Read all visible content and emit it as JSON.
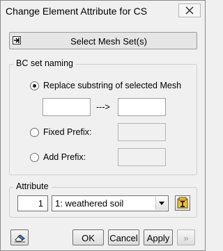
{
  "window": {
    "title": "Change Element Attribute for CS"
  },
  "select_mesh": {
    "label": "Select Mesh Set(s)"
  },
  "bc_naming": {
    "group_label": "BC set naming",
    "options": [
      {
        "label": "Replace substring of selected Mesh",
        "checked": true
      },
      {
        "label": "Fixed Prefix:",
        "checked": false
      },
      {
        "label": "Add Prefix:",
        "checked": false
      }
    ],
    "replace_from": "",
    "replace_arrow": "--->",
    "replace_to": "",
    "fixed_prefix": "",
    "add_prefix": ""
  },
  "attribute": {
    "group_label": "Attribute",
    "number": "1",
    "selected": "1: weathered soil"
  },
  "buttons": {
    "ok": "OK",
    "cancel": "Cancel",
    "apply": "Apply",
    "more": "»"
  },
  "icons": {
    "close": "close-icon",
    "select_mesh": "arrow-select-icon",
    "attribute_table": "table-icon",
    "eraser": "eraser-icon"
  }
}
